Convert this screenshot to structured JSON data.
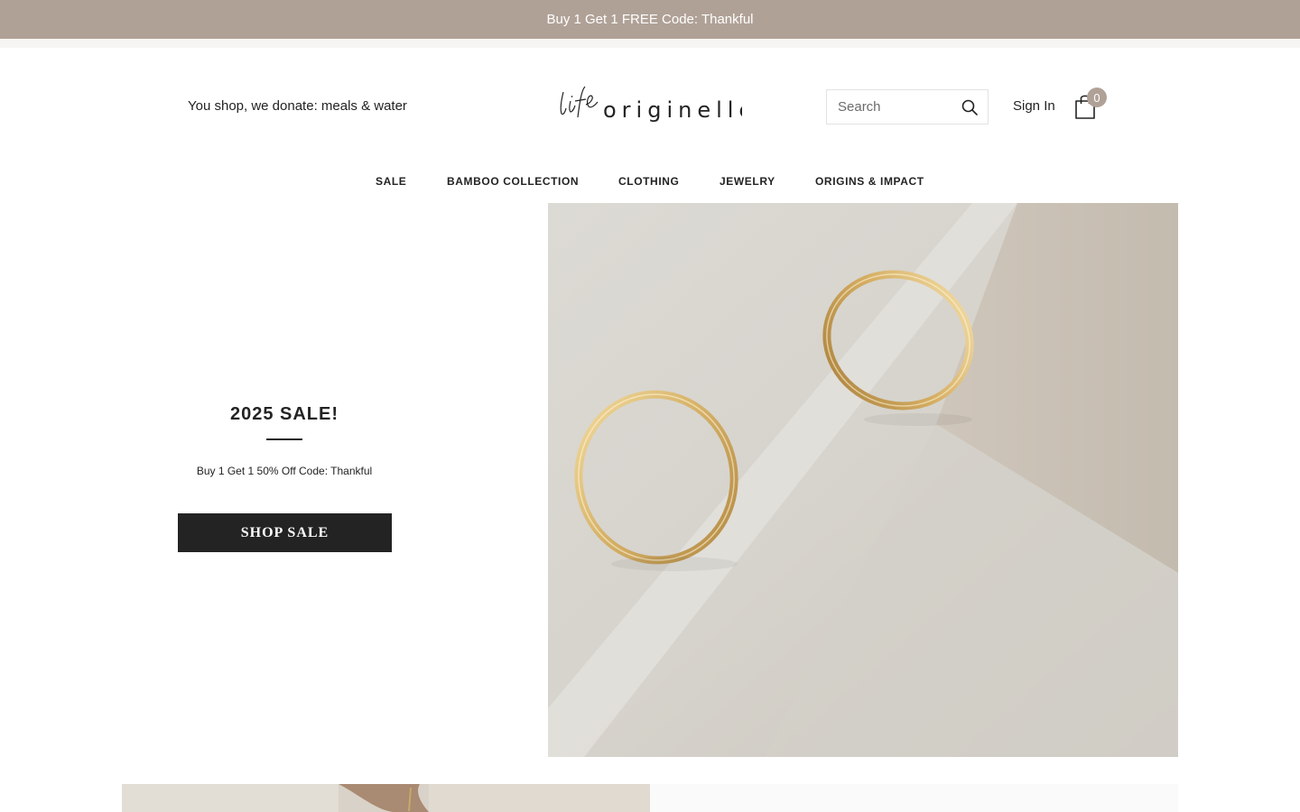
{
  "announcement": {
    "text": "Buy 1 Get 1 FREE Code: Thankful",
    "bg_color": "#b0a197"
  },
  "header": {
    "tagline": "You shop, we donate: meals & water",
    "logo": {
      "word1": "life",
      "word2": "originelle"
    },
    "search": {
      "placeholder": "Search",
      "value": ""
    },
    "signin_label": "Sign In",
    "cart_count": "0"
  },
  "nav": {
    "items": [
      {
        "label": "SALE"
      },
      {
        "label": "BAMBOO COLLECTION"
      },
      {
        "label": "CLOTHING"
      },
      {
        "label": "JEWELRY"
      },
      {
        "label": "ORIGINS & IMPACT"
      }
    ]
  },
  "hero": {
    "title": "2025 SALE!",
    "subtitle": "Buy 1 Get 1 50% Off Code: Thankful",
    "button_label": "SHOP SALE",
    "image": "gold-hoop-earrings-photo"
  },
  "icons": {
    "search": "search-icon",
    "cart": "shopping-bag-icon"
  },
  "colors": {
    "accent": "#b0a197",
    "text": "#232323",
    "button_bg": "#232323"
  }
}
